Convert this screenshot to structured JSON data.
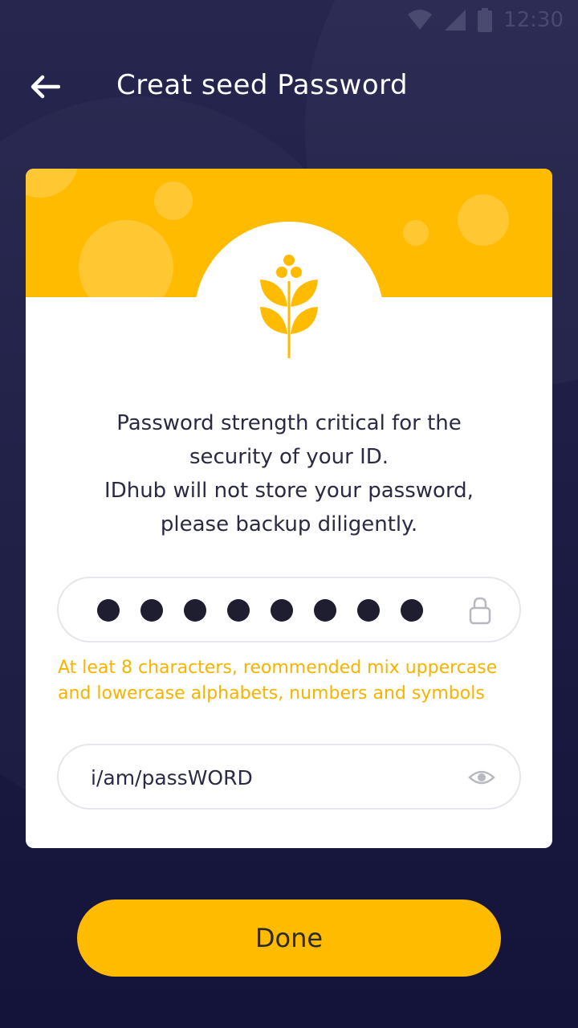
{
  "status_bar": {
    "time": "12:30",
    "icons": [
      "wifi-icon",
      "signal-icon",
      "battery-icon"
    ]
  },
  "header": {
    "back_icon": "arrow-left-icon",
    "title": "Creat seed Password"
  },
  "card": {
    "illustration": "sprout-icon",
    "description": [
      "Password strength critical for the",
      "security of your ID.",
      "IDhub will not store your password,",
      "please backup diligently."
    ],
    "password_field": {
      "masked_length": 8,
      "icon": "lock-icon"
    },
    "password_rule": [
      "At leat 8 characters, reommended mix uppercase",
      "and lowercase alphabets, numbers and symbols"
    ],
    "hint_field": {
      "value": "i/am/passWORD",
      "icon": "eye-icon"
    }
  },
  "done_button": {
    "label": "Done"
  },
  "colors": {
    "accent": "#ffbb00",
    "background": "#1d1d45",
    "warning_text": "#f5b400"
  }
}
